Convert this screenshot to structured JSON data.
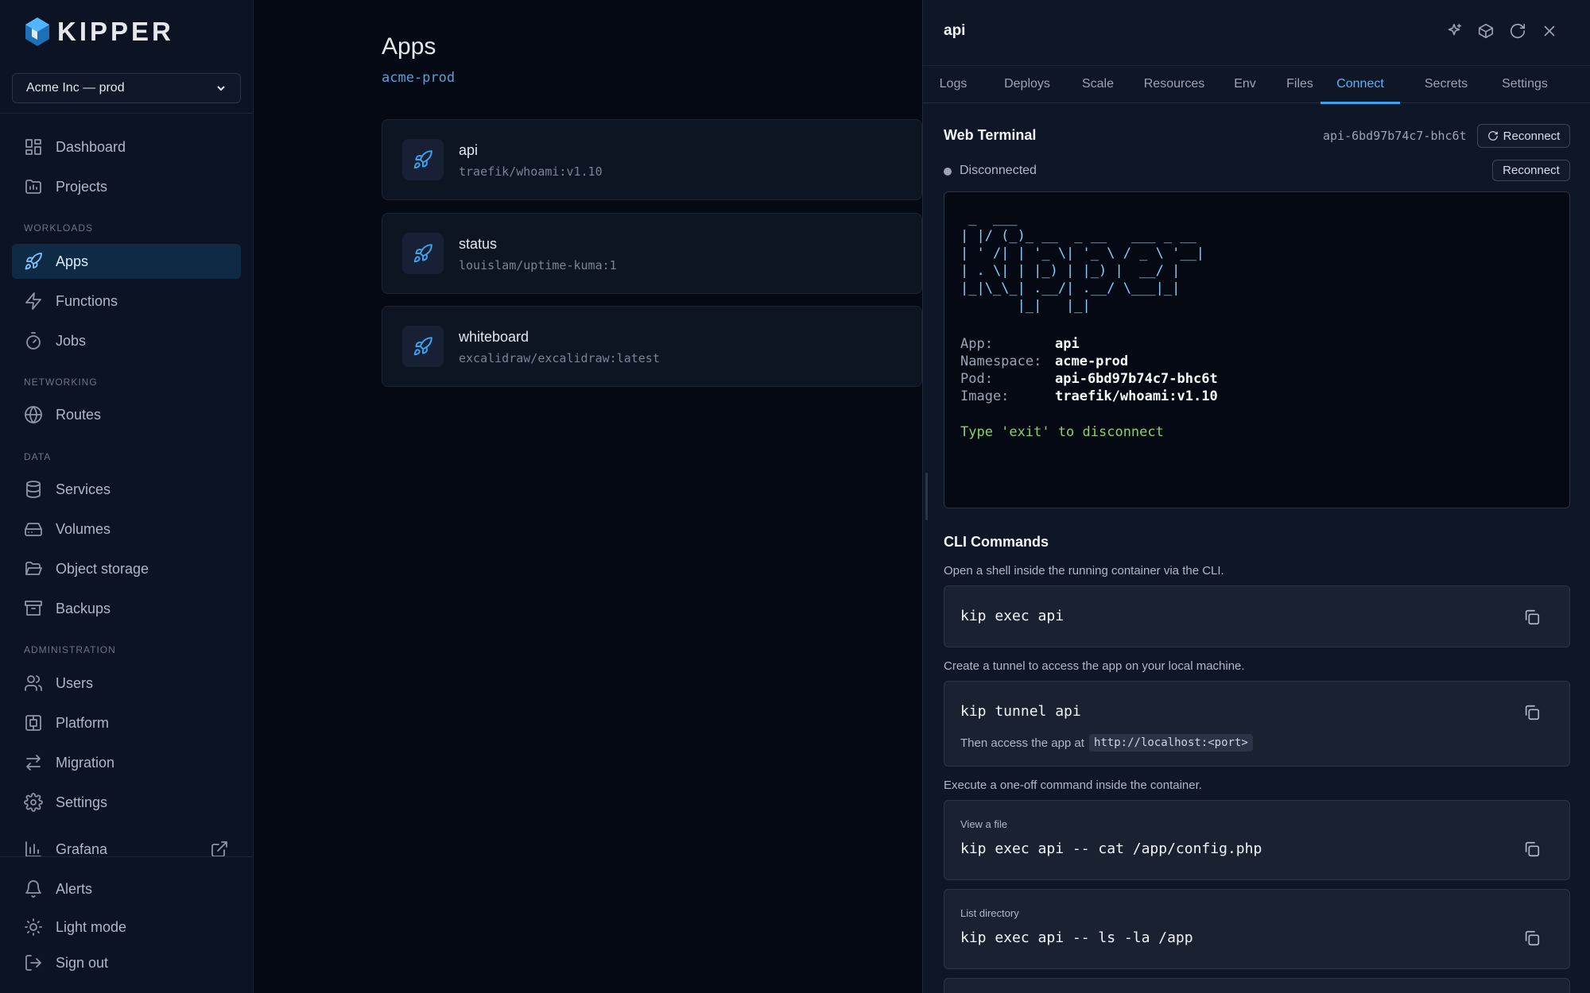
{
  "brand": {
    "name": "KIPPER"
  },
  "environment": {
    "selected": "Acme Inc — prod"
  },
  "sidebar": {
    "top_items": [
      {
        "label": "Dashboard",
        "icon": "dashboard-icon"
      },
      {
        "label": "Projects",
        "icon": "folder-icon"
      }
    ],
    "sections": [
      {
        "title": "WORKLOADS",
        "items": [
          {
            "label": "Apps",
            "icon": "rocket-icon",
            "active": true
          },
          {
            "label": "Functions",
            "icon": "bolt-icon"
          },
          {
            "label": "Jobs",
            "icon": "timer-icon"
          }
        ]
      },
      {
        "title": "NETWORKING",
        "items": [
          {
            "label": "Routes",
            "icon": "globe-icon"
          }
        ]
      },
      {
        "title": "DATA",
        "items": [
          {
            "label": "Services",
            "icon": "database-icon"
          },
          {
            "label": "Volumes",
            "icon": "drive-icon"
          },
          {
            "label": "Object storage",
            "icon": "folder-open-icon"
          },
          {
            "label": "Backups",
            "icon": "archive-icon"
          }
        ]
      },
      {
        "title": "ADMINISTRATION",
        "items": [
          {
            "label": "Users",
            "icon": "users-icon"
          },
          {
            "label": "Platform",
            "icon": "platform-icon"
          },
          {
            "label": "Migration",
            "icon": "arrows-icon"
          },
          {
            "label": "Settings",
            "icon": "gear-icon"
          }
        ]
      }
    ],
    "grafana": {
      "label": "Grafana",
      "icon": "bar-chart-icon"
    },
    "bottom_items": [
      {
        "label": "Alerts",
        "icon": "bell-icon"
      },
      {
        "label": "Light mode",
        "icon": "sun-icon"
      },
      {
        "label": "Sign out",
        "icon": "sign-out-icon"
      }
    ]
  },
  "main": {
    "title": "Apps",
    "namespace": "acme-prod",
    "apps": [
      {
        "name": "api",
        "image": "traefik/whoami:v1.10"
      },
      {
        "name": "status",
        "image": "louislam/uptime-kuma:1"
      },
      {
        "name": "whiteboard",
        "image": "excalidraw/excalidraw:latest"
      }
    ]
  },
  "panel": {
    "title": "api",
    "tabs": [
      "Logs",
      "Deploys",
      "Scale",
      "Resources",
      "Env",
      "Files",
      "Connect",
      "Secrets",
      "Settings"
    ],
    "active_tab": "Connect",
    "web_terminal": {
      "title": "Web Terminal",
      "pod": "api-6bd97b74c7-bhc6t",
      "reconnect_label": "Reconnect",
      "status": "Disconnected",
      "ascii_art": " _  ___\n| |/ (_)_ __  _ __   ___ _ __\n| ' /| | '_ \\| '_ \\ / _ \\ '__|\n| . \\| | |_) | |_) |  __/ |\n|_|\\_\\_| .__/| .__/ \\___|_|\n       |_|   |_|",
      "info": [
        {
          "key": "App:",
          "value": "api"
        },
        {
          "key": "Namespace:",
          "value": "acme-prod"
        },
        {
          "key": "Pod:",
          "value": "api-6bd97b74c7-bhc6t"
        },
        {
          "key": "Image:",
          "value": "traefik/whoami:v1.10"
        }
      ],
      "exit_message": "Type 'exit' to disconnect"
    },
    "cli": {
      "title": "CLI Commands",
      "shell_desc": "Open a shell inside the running container via the CLI.",
      "shell_cmd": "kip exec api",
      "tunnel_desc": "Create a tunnel to access the app on your local machine.",
      "tunnel_cmd": "kip tunnel api",
      "tunnel_hint": "Then access the app at",
      "tunnel_url": "http://localhost:<port>",
      "oneoff_desc": "Execute a one-off command inside the container.",
      "examples": [
        {
          "label": "View a file",
          "cmd": "kip exec api -- cat /app/config.php"
        },
        {
          "label": "List directory",
          "cmd": "kip exec api -- ls -la /app"
        }
      ]
    }
  }
}
